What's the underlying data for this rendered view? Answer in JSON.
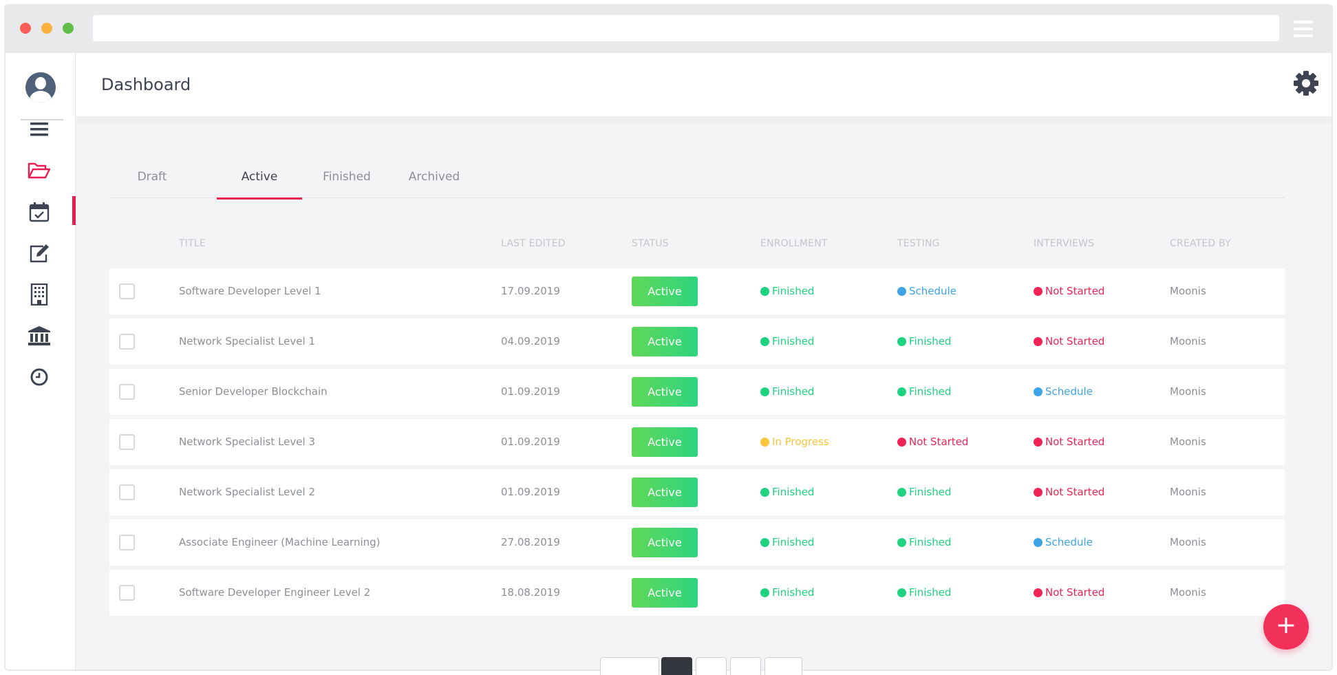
{
  "header": {
    "title": "Dashboard"
  },
  "sidebar": {
    "items": [
      {
        "icon": "menu-icon"
      },
      {
        "icon": "folder-open-icon",
        "active": true
      },
      {
        "icon": "calendar-check-icon"
      },
      {
        "icon": "edit-icon"
      },
      {
        "icon": "building-icon"
      },
      {
        "icon": "bank-icon"
      },
      {
        "icon": "clock-icon"
      }
    ]
  },
  "tabs": [
    {
      "label": "Draft"
    },
    {
      "label": "Active",
      "active": true
    },
    {
      "label": "Finished"
    },
    {
      "label": "Archived"
    }
  ],
  "table": {
    "columns": [
      "TITLE",
      "LAST EDITED",
      "STATUS",
      "ENROLLMENT",
      "TESTING",
      "INTERVIEWS",
      "CREATED BY"
    ],
    "rows": [
      {
        "title": "Software Developer Level 1",
        "last_edited": "17.09.2019",
        "status": "Active",
        "enrollment": "Finished",
        "testing": "Schedule",
        "interviews": "Not Started",
        "created_by": "Moonis"
      },
      {
        "title": "Network Specialist Level 1",
        "last_edited": "04.09.2019",
        "status": "Active",
        "enrollment": "Finished",
        "testing": "Finished",
        "interviews": "Not Started",
        "created_by": "Moonis"
      },
      {
        "title": "Senior Developer Blockchain",
        "last_edited": "01.09.2019",
        "status": "Active",
        "enrollment": "Finished",
        "testing": "Finished",
        "interviews": "Schedule",
        "created_by": "Moonis"
      },
      {
        "title": "Network Specialist Level 3",
        "last_edited": "01.09.2019",
        "status": "Active",
        "enrollment": "In Progress",
        "testing": "Not Started",
        "interviews": "Not Started",
        "created_by": "Moonis"
      },
      {
        "title": "Network Specialist Level 2",
        "last_edited": "01.09.2019",
        "status": "Active",
        "enrollment": "Finished",
        "testing": "Finished",
        "interviews": "Not Started",
        "created_by": "Moonis"
      },
      {
        "title": "Associate Engineer (Machine Learning)",
        "last_edited": "27.08.2019",
        "status": "Active",
        "enrollment": "Finished",
        "testing": "Finished",
        "interviews": "Schedule",
        "created_by": "Moonis"
      },
      {
        "title": "Software Developer Engineer Level 2",
        "last_edited": "18.08.2019",
        "status": "Active",
        "enrollment": "Finished",
        "testing": "Finished",
        "interviews": "Not Started",
        "created_by": "Moonis"
      }
    ]
  },
  "stage_colors": {
    "Finished": "#1ed37f",
    "Schedule": "#3ea3e6",
    "Not Started": "#ef2454",
    "In Progress": "#fbc43b"
  },
  "fab": {
    "label": "+"
  }
}
